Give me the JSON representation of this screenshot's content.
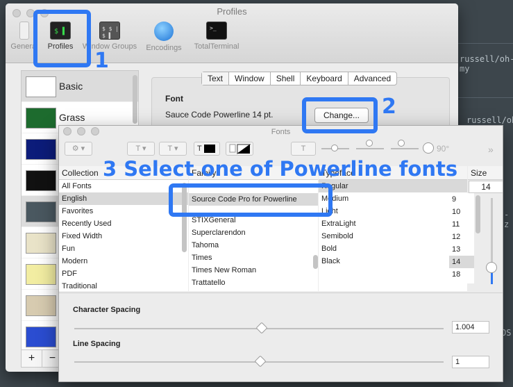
{
  "background_terminal": {
    "lines": [
      "russell/oh-my",
      "russell/oh-m",
      "-z",
      "OS"
    ]
  },
  "prefs_window": {
    "title": "Profiles",
    "toolbar": [
      {
        "label": "General",
        "icon": "switch-icon"
      },
      {
        "label": "Profiles",
        "icon": "terminal-profile-icon"
      },
      {
        "label": "Window Groups",
        "icon": "window-groups-icon"
      },
      {
        "label": "Encodings",
        "icon": "globe-icon"
      },
      {
        "label": "TotalTerminal",
        "icon": "total-terminal-icon"
      }
    ],
    "profiles": [
      "Basic",
      "Grass"
    ],
    "tabs": [
      "Text",
      "Window",
      "Shell",
      "Keyboard",
      "Advanced"
    ],
    "selected_tab": "Text",
    "font_heading": "Font",
    "font_value": "Sauce Code Powerline 14 pt.",
    "change_button": "Change...",
    "add_button": "+",
    "remove_button": "−"
  },
  "fonts_panel": {
    "title": "Fonts",
    "rotation": "90°",
    "columns": {
      "collection_header": "Collection",
      "family_header": "Family",
      "typeface_header": "Typeface",
      "size_header": "Size"
    },
    "collections": [
      "All Fonts",
      "English",
      "Favorites",
      "Recently Used",
      "Fixed Width",
      "Fun",
      "Modern",
      "PDF",
      "Traditional"
    ],
    "selected_collection": "English",
    "families": [
      "Source Code Pro for Powerline",
      "STIXGeneral",
      "Superclarendon",
      "Tahoma",
      "Times",
      "Times New Roman",
      "Trattatello"
    ],
    "typefaces": [
      "Regular",
      "Medium",
      "Light",
      "ExtraLight",
      "Semibold",
      "Bold",
      "Black"
    ],
    "size_value": "14",
    "sizes": [
      "9",
      "10",
      "11",
      "12",
      "13",
      "14",
      "18"
    ],
    "selected_size": "14",
    "character_spacing_label": "Character Spacing",
    "character_spacing_value": "1.004",
    "line_spacing_label": "Line Spacing",
    "line_spacing_value": "1"
  },
  "annotations": {
    "step1": "1",
    "step2": "2",
    "step3": "3 Select one of Powerline fonts"
  },
  "colors": {
    "annotation": "#2f78f3"
  }
}
